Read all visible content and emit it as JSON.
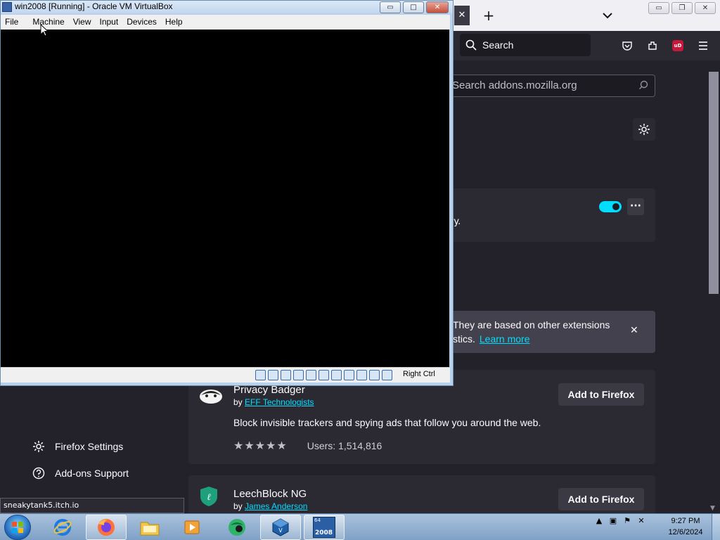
{
  "firefox": {
    "tabbar": {
      "tab_close": "✕",
      "new_tab": "+",
      "window_controls": [
        "▭",
        "❐",
        "✕"
      ]
    },
    "toolbar": {
      "search_placeholder": "Search",
      "icons": [
        "pocket-icon",
        "extensions-icon",
        "ublock-origin-icon",
        "hamburger-menu-icon"
      ],
      "ublock_label": "uD"
    },
    "content": {
      "amo_search_placeholder": "Search addons.mozilla.org",
      "extension_card": {
        "description_fragment": "ry.",
        "more_label": "···",
        "enabled": true
      },
      "notice": {
        "line1": "They are based on other extensions",
        "line2": "stics.",
        "link": "Learn more",
        "close": "✕"
      },
      "sidebar": {
        "settings": "Firefox Settings",
        "support": "Add-ons Support"
      },
      "recommendations": [
        {
          "name": "Privacy Badger",
          "by_prefix": "by",
          "author": "EFF Technologists",
          "description": "Block invisible trackers and spying ads that follow you around the web.",
          "stars": "★★★★★",
          "rating": 5,
          "users": "Users: 1,514,816",
          "button": "Add to Firefox"
        },
        {
          "name": "LeechBlock NG",
          "by_prefix": "by",
          "author": "James Anderson",
          "button": "Add to Firefox"
        }
      ],
      "status_url": "sneakytank5.itch.io"
    },
    "colors": {
      "accent": "#00ddff",
      "background": "#23222b",
      "card": "#2b2a33"
    }
  },
  "virtualbox": {
    "title": "win2008 [Running] - Oracle VM VirtualBox",
    "menu": [
      "File",
      "Machine",
      "View",
      "Input",
      "Devices",
      "Help"
    ],
    "controls": [
      "▭",
      "□",
      "✕"
    ],
    "host_key": "Right Ctrl"
  },
  "taskbar": {
    "apps": [
      "internet-explorer",
      "firefox",
      "windows-explorer",
      "media-player",
      "app-green-globe",
      "virtualbox",
      "win2008-vm"
    ],
    "vm_label_top": "64",
    "vm_label": "2008",
    "clock_time": "9:27 PM",
    "clock_date": "12/6/2024"
  }
}
